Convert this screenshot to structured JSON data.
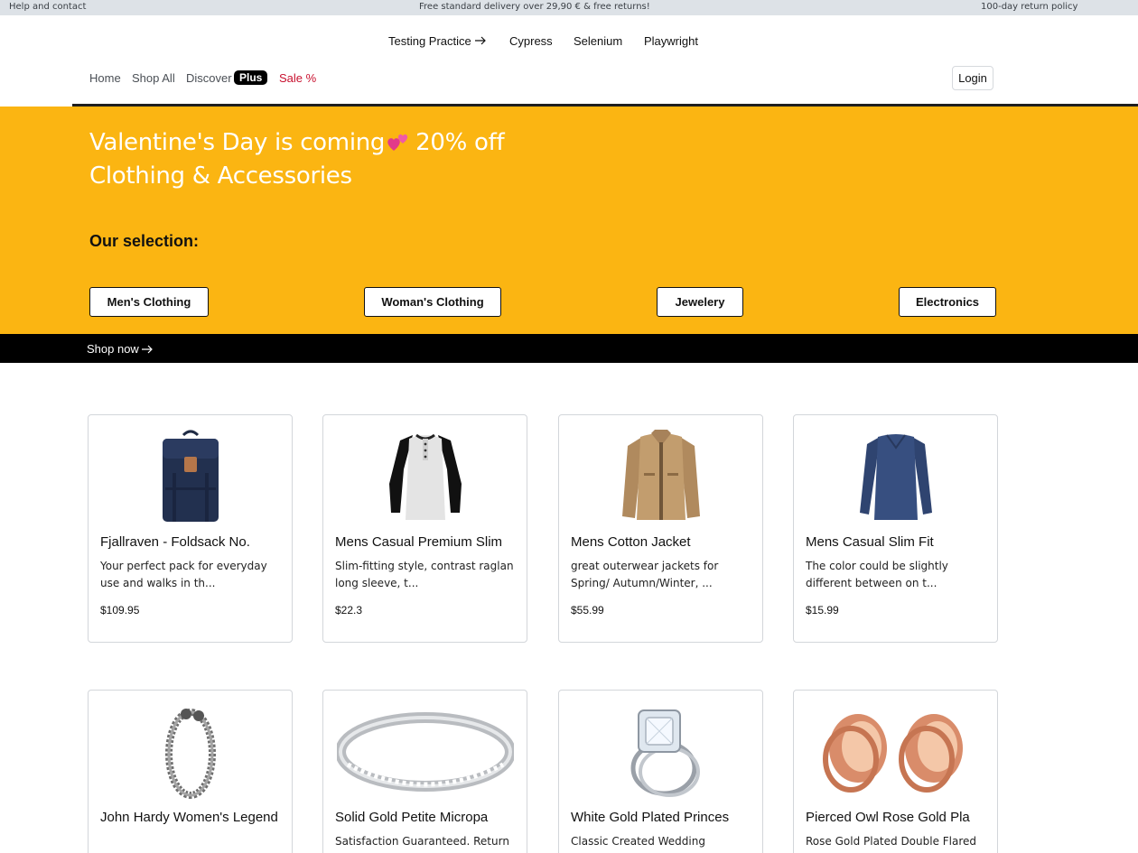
{
  "topbar": {
    "help": "Help and contact",
    "delivery": "Free standard delivery over 29,90 € & free returns!",
    "returns": "100-day return policy"
  },
  "subnav": {
    "testing_practice": "Testing Practice",
    "cypress": "Cypress",
    "selenium": "Selenium",
    "playwright": "Playwright"
  },
  "nav": {
    "home": "Home",
    "shop_all": "Shop All",
    "discover": "Discover",
    "plus": "Plus",
    "sale": "Sale %",
    "login": "Login"
  },
  "hero": {
    "title_part1": "Valentine's Day is coming",
    "title_part2": "20% off",
    "title_line2": "Clothing & Accessories",
    "selection_label": "Our selection:",
    "categories": [
      "Men's Clothing",
      "Woman's Clothing",
      "Jewelery",
      "Electronics"
    ],
    "shop_now": "Shop now"
  },
  "products": [
    {
      "title": "Fjallraven - Foldsack No.",
      "description": "Your perfect pack for everyday use and walks in th...",
      "price": "$109.95",
      "image": "backpack"
    },
    {
      "title": "Mens Casual Premium Slim",
      "description": "Slim-fitting style, contrast raglan long sleeve, t...",
      "price": "$22.3",
      "image": "raglan-shirt"
    },
    {
      "title": "Mens Cotton Jacket",
      "description": "great outerwear jackets for Spring/ Autumn/Winter, ...",
      "price": "$55.99",
      "image": "jacket"
    },
    {
      "title": "Mens Casual Slim Fit",
      "description": "The color could be slightly different between on t...",
      "price": "$15.99",
      "image": "long-sleeve-shirt"
    },
    {
      "title": "John Hardy Women's Legend",
      "description": "",
      "price": "",
      "image": "bracelet"
    },
    {
      "title": "Solid Gold Petite Micropa",
      "description": "Satisfaction Guaranteed. Return or",
      "price": "",
      "image": "ring-band"
    },
    {
      "title": "White Gold Plated Princes",
      "description": "Classic Created Wedding",
      "price": "",
      "image": "engagement-ring"
    },
    {
      "title": "Pierced Owl Rose Gold Pla",
      "description": "Rose Gold Plated Double Flared",
      "price": "",
      "image": "ear-tunnels"
    }
  ],
  "colors": {
    "hero_bg": "#fbb512",
    "sale_red": "#c8102e",
    "topbar_bg": "#dde2e7",
    "shopbar_bg": "#000000"
  }
}
